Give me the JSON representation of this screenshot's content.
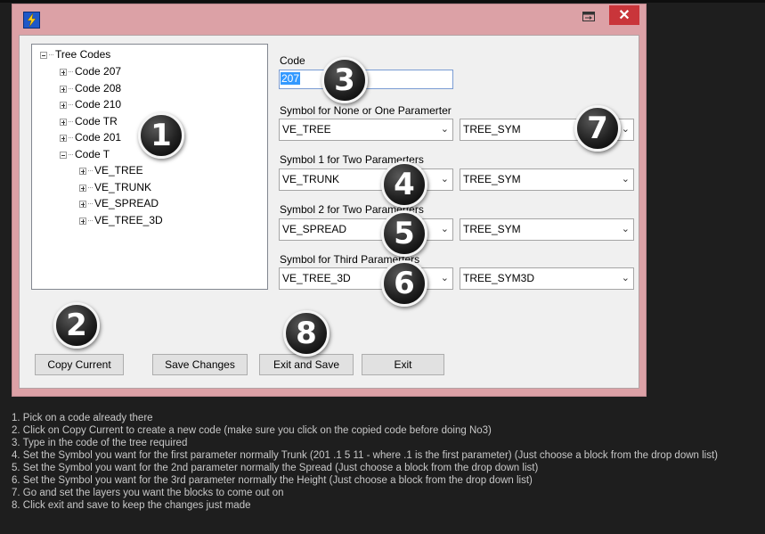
{
  "window": {
    "app_icon": "lightning-icon",
    "restore_icon": "restore-icon",
    "close_icon": "close-icon",
    "close_glyph": "✕"
  },
  "tree": {
    "root": "Tree Codes",
    "items": [
      "Code 207",
      "Code 208",
      "Code 210",
      "Code TR",
      "Code 201",
      "Code T"
    ],
    "children": [
      "VE_TREE",
      "VE_TRUNK",
      "VE_SPREAD",
      "VE_TREE_3D"
    ]
  },
  "form": {
    "code_label": "Code",
    "code_value": "207",
    "rows": [
      {
        "label": "Symbol for None or One Paramerter",
        "left": "VE_TREE",
        "right": "TREE_SYM"
      },
      {
        "label": "Symbol 1 for Two Paramerters",
        "left": "VE_TRUNK",
        "right": "TREE_SYM"
      },
      {
        "label": "Symbol 2 for Two Paramerters",
        "left": "VE_SPREAD",
        "right": "TREE_SYM"
      },
      {
        "label": "Symbol for Third Paramerters",
        "left": "VE_TREE_3D",
        "right": "TREE_SYM3D"
      }
    ]
  },
  "buttons": {
    "copy_current": "Copy Current",
    "save_changes": "Save Changes",
    "exit_and_save": "Exit and Save",
    "exit": "Exit"
  },
  "badges": [
    "1",
    "2",
    "3",
    "4",
    "5",
    "6",
    "7",
    "8"
  ],
  "instructions": [
    "1. Pick on a code already there",
    "2. Click on Copy Current to create a new code (make sure you click on the copied code before doing No3)",
    "3. Type in the code of the tree required",
    "4. Set the Symbol you want for the first parameter normally Trunk (201 .1 5 11 - where .1 is the first parameter) (Just choose a block from the drop down list)",
    "5. Set the Symbol you want for the 2nd parameter normally the Spread (Just choose a block from the drop down list)",
    "6. Set the Symbol you want for the 3rd parameter normally the Height (Just choose a block from the drop down list)",
    "7. Go and set the layers you want the blocks to come out on",
    "8. Click exit and save to keep the changes just made"
  ]
}
